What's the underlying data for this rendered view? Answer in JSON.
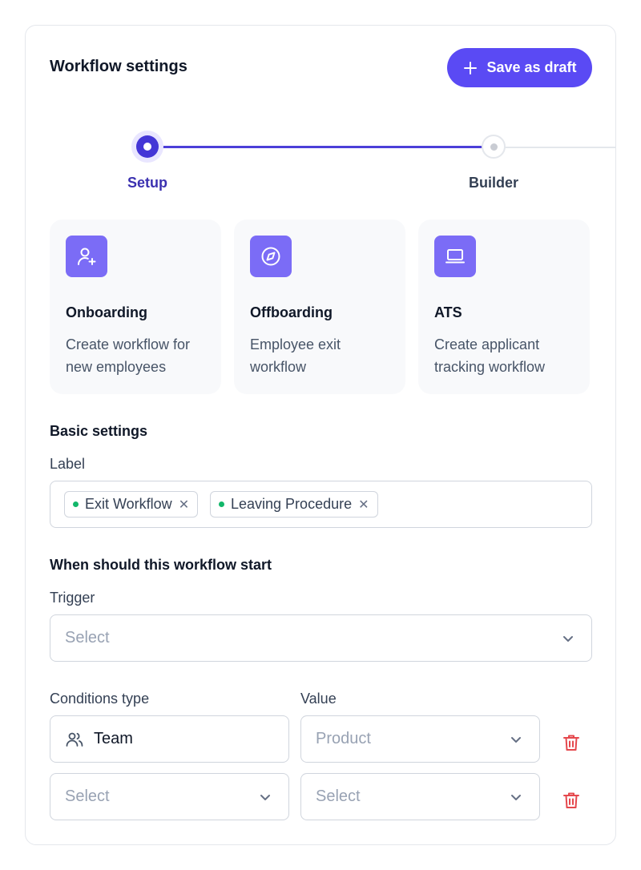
{
  "header": {
    "title": "Workflow settings",
    "save_label": "Save as draft"
  },
  "stepper": {
    "steps": [
      {
        "label": "Setup",
        "state": "active"
      },
      {
        "label": "Builder",
        "state": "inactive"
      }
    ]
  },
  "types": [
    {
      "title": "Onboarding",
      "desc": "Create workflow for new employees",
      "icon": "user-plus-icon"
    },
    {
      "title": "Offboarding",
      "desc": "Employee exit workflow",
      "icon": "compass-icon"
    },
    {
      "title": "ATS",
      "desc": "Create applicant tracking workflow",
      "icon": "laptop-icon"
    }
  ],
  "basic": {
    "section_title": "Basic settings",
    "label_field": "Label",
    "tags": [
      "Exit Workflow",
      "Leaving Procedure"
    ]
  },
  "trigger": {
    "section_title": "When should this workflow start",
    "field_label": "Trigger",
    "placeholder": "Select"
  },
  "conditions": {
    "type_label": "Conditions type",
    "value_label": "Value",
    "rows": [
      {
        "type": "Team",
        "value": "Product"
      },
      {
        "type": "Select",
        "value": "Select"
      }
    ]
  },
  "colors": {
    "accent": "#5a4af4",
    "step_active": "#4436d6",
    "danger": "#e5484d",
    "tag_dot": "#12b76a"
  }
}
